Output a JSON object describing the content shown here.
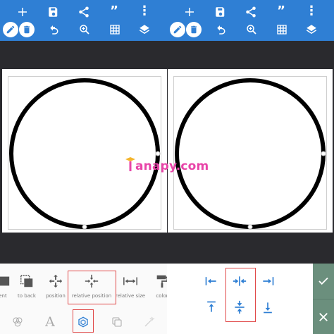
{
  "tools": {
    "items": [
      {
        "name": "ent",
        "label": "ent"
      },
      {
        "name": "to-back",
        "label": "to back"
      },
      {
        "name": "position",
        "label": "position"
      },
      {
        "name": "relative-position",
        "label": "relative position"
      },
      {
        "name": "relative-size",
        "label": "relative size"
      },
      {
        "name": "color",
        "label": "color"
      }
    ]
  },
  "tabs": {
    "text_glyph": "A"
  },
  "watermark": {
    "text": "anapy.com"
  },
  "colors": {
    "toolbar": "#2f7fd4",
    "dark": "#2a2a2e",
    "highlight": "#e04848",
    "align_icon": "#2f7fd4",
    "confirm_panel": "#6b8f7d",
    "watermark": "#e844a8"
  },
  "toolbar": {
    "quote_glyph": "”",
    "more_glyph": "⋮"
  }
}
